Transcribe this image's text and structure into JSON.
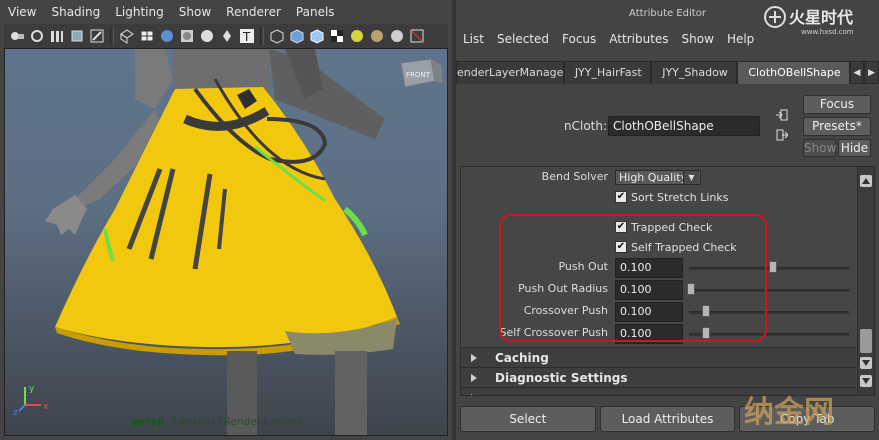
{
  "viewport": {
    "menu": [
      "View",
      "Shading",
      "Lighting",
      "Show",
      "Renderer",
      "Panels"
    ],
    "camera_name": "persp",
    "layer_label": "(defaultRenderLayer)",
    "view_cube_label": "FRONT",
    "axis_labels": {
      "x": "x",
      "y": "y",
      "z": "z"
    }
  },
  "attribute_editor": {
    "title": "Attribute Editor",
    "menu": [
      "List",
      "Selected",
      "Focus",
      "Attributes",
      "Show",
      "Help"
    ],
    "tabs": [
      "enderLayerManager",
      "JYY_HairFast",
      "JYY_Shadow",
      "ClothOBellShape"
    ],
    "active_tab": "ClothOBellShape",
    "node_type_label": "nCloth:",
    "node_name": "ClothOBellShape",
    "buttons": {
      "focus": "Focus",
      "presets": "Presets*",
      "show": "Show",
      "hide": "Hide"
    },
    "attributes": {
      "bend_solver_label": "Bend Solver",
      "bend_solver_value": "High Quality",
      "sort_stretch_links": "Sort Stretch Links",
      "trapped_check": "Trapped Check",
      "self_trapped_check": "Self Trapped Check",
      "push_out_label": "Push Out",
      "push_out_value": "0.100",
      "push_out_radius_label": "Push Out Radius",
      "push_out_radius_value": "0.100",
      "crossover_push_label": "Crossover Push",
      "crossover_push_value": "0.100",
      "self_crossover_push_label": "Self Crossover Push",
      "self_crossover_push_value": "0.100"
    },
    "sections": [
      "Caching",
      "Diagnostic Settings"
    ],
    "footer": {
      "select": "Select",
      "load_attributes": "Load Attributes",
      "copy_tab": "Copy Tab"
    }
  },
  "watermarks": {
    "top": "火星时代",
    "top_url": "www.hxsd.com",
    "bottom": "纳金网"
  },
  "colors": {
    "highlight": "#d4141c",
    "cloth_yellow": "#f2c80f",
    "panel_bg": "#444444"
  }
}
